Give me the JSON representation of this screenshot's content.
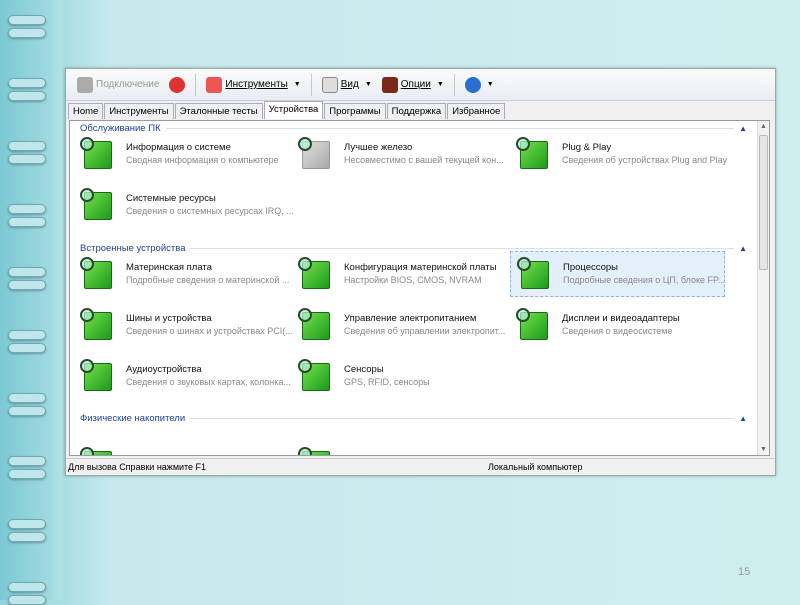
{
  "toolbar": {
    "connect": "Подключение",
    "tools": "Инструменты",
    "view": "Вид",
    "options": "Опции"
  },
  "tabs": [
    "Home",
    "Инструменты",
    "Эталонные тесты",
    "Устройства",
    "Программы",
    "Поддержка",
    "Избранное"
  ],
  "active_tab": "Устройства",
  "groups": [
    {
      "title": "Обслуживание ПК",
      "items": [
        {
          "title": "Информация о системе",
          "desc": "Сводная информация о компьютере"
        },
        {
          "title": "Лучшее железо",
          "desc": "Несовместимо с вашей текущей кон..."
        },
        {
          "title": "Plug & Play",
          "desc": "Сведения об устройствах Plug and Play"
        },
        {
          "title": "Системные ресурсы",
          "desc": "Сведения о системных ресурсах IRQ, ..."
        }
      ]
    },
    {
      "title": "Встроенные устройства",
      "items": [
        {
          "title": "Материнская плата",
          "desc": "Подробные сведения о материнской ..."
        },
        {
          "title": "Конфигурация материнской платы",
          "desc": "Настройки BIOS, CMOS, NVRAM"
        },
        {
          "title": "Процессоры",
          "desc": "Подробные сведения о ЦП, блоке FP..."
        },
        {
          "title": "Шины и устройства",
          "desc": "Сведения о шинах и устройствах PCI(..."
        },
        {
          "title": "Управление электропитанием",
          "desc": "Сведения об управлении электропит..."
        },
        {
          "title": "Дисплеи и видеоадаптеры",
          "desc": "Сведения о видеосистеме"
        },
        {
          "title": "Аудиоустройства",
          "desc": "Сведения о звуковых картах, колонка..."
        },
        {
          "title": "Сенсоры",
          "desc": "GPS, RFID, сенсоры"
        }
      ]
    },
    {
      "title": "Физические накопители",
      "items": [
        {
          "title": "Физические диски",
          "desc": ""
        },
        {
          "title": "Устройства SCSI",
          "desc": ""
        }
      ]
    }
  ],
  "status": {
    "left": "Для вызова Справки нажмите F1",
    "right": "Локальный компьютер"
  },
  "page_number": "15"
}
